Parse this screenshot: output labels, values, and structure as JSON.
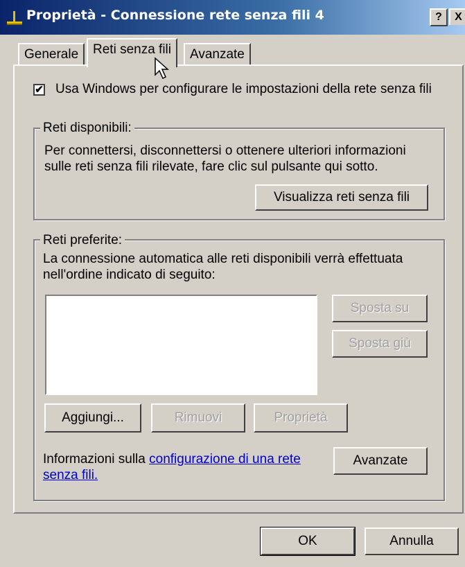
{
  "window": {
    "title": "Proprietà - Connessione rete senza fili 4",
    "help_label": "?",
    "close_label": "X"
  },
  "tabs": [
    {
      "label": "Generale"
    },
    {
      "label": "Reti senza fili"
    },
    {
      "label": "Avanzate"
    }
  ],
  "use_windows": {
    "label": "Usa Windows per configurare le impostazioni della rete senza fili",
    "checked": true,
    "check_glyph": "✔"
  },
  "available": {
    "title": "Reti disponibili:",
    "line1": "Per connettersi, disconnettersi o ottenere ulteriori informazioni",
    "line2": "sulle reti senza fili rilevate, fare clic sul pulsante qui sotto.",
    "view_button": "Visualizza reti senza fili"
  },
  "preferred": {
    "title": "Reti preferite:",
    "line1": "La connessione automatica alle reti disponibili verrà effettuata",
    "line2": "nell'ordine indicato di seguito:",
    "move_up": "Sposta su",
    "move_down": "Sposta giù",
    "add": "Aggiungi...",
    "remove": "Rimuovi",
    "properties": "Proprietà",
    "info_prefix": "Informazioni sulla ",
    "info_link_1": "configurazione di una rete",
    "info_link_2": "senza fili.",
    "advanced": "Avanzate"
  },
  "footer": {
    "ok": "OK",
    "cancel": "Annulla"
  }
}
